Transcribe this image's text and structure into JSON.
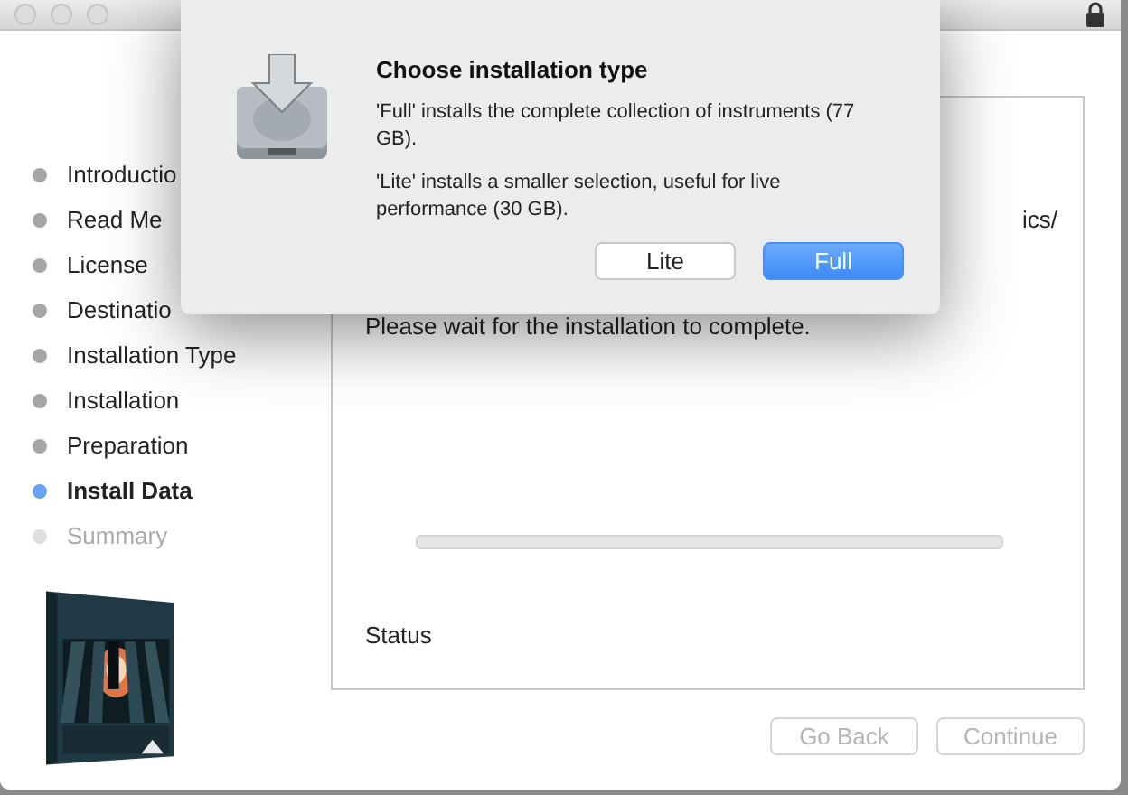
{
  "sidebar": {
    "items": [
      {
        "label": "Introductio",
        "selected": false,
        "disabled": false
      },
      {
        "label": "Read Me",
        "selected": false,
        "disabled": false
      },
      {
        "label": "License",
        "selected": false,
        "disabled": false
      },
      {
        "label": "Destinatio",
        "selected": false,
        "disabled": false
      },
      {
        "label": "Installation Type",
        "selected": false,
        "disabled": false
      },
      {
        "label": "Installation",
        "selected": false,
        "disabled": false
      },
      {
        "label": "Preparation",
        "selected": false,
        "disabled": false
      },
      {
        "label": "Install Data",
        "selected": true,
        "disabled": false
      },
      {
        "label": "Summary",
        "selected": false,
        "disabled": true
      }
    ]
  },
  "content": {
    "text_fragment": "ics/",
    "message": "Please wait for the installation to complete.",
    "progress": {
      "level": 0
    },
    "status": "Status"
  },
  "buttons": [
    {
      "label": "Go Back",
      "disabled": true
    },
    {
      "label": "Continue",
      "disabled": true
    }
  ],
  "sheet": {
    "title": "Choose installation type",
    "paragraphs": [
      "'Full' installs the complete collection of instruments (77 GB).",
      "'Lite' installs a smaller selection, useful for live performance (30 GB)."
    ],
    "buttons": [
      {
        "label": "Lite",
        "default": false
      },
      {
        "label": "Full",
        "default": true
      }
    ]
  }
}
